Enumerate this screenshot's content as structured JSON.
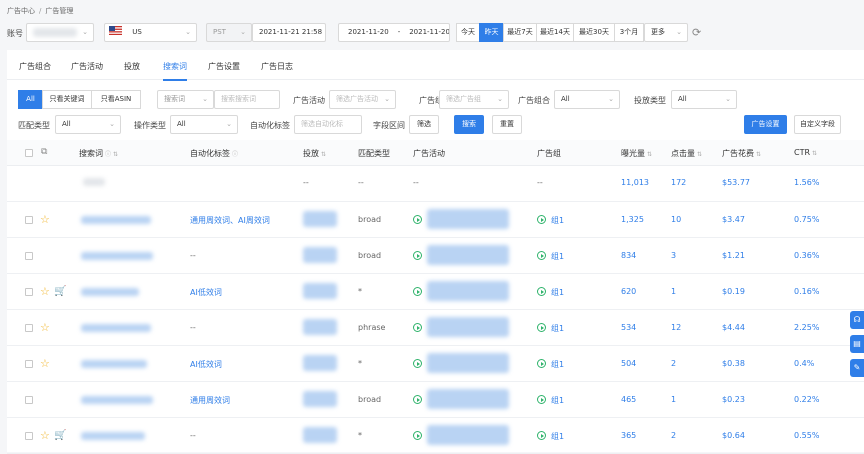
{
  "breadcrumb": {
    "root": "广告中心",
    "sep": "/",
    "current": "广告管理"
  },
  "topbar": {
    "account_label": "账号",
    "market": "US",
    "timezone": "PST",
    "datetime": "2021-11-21 21:58",
    "range_start": "2021-11-20",
    "range_sep": "-",
    "range_end": "2021-11-20",
    "quick_ranges": [
      "今天",
      "昨天",
      "最近7天",
      "最近14天",
      "最近30天",
      "3个月"
    ],
    "active_range": "昨天",
    "more": "更多",
    "refresh_icon": "refresh-icon"
  },
  "tabs": [
    "广告组合",
    "广告活动",
    "投放",
    "搜索词",
    "广告设置",
    "广告日志"
  ],
  "active_tab": "搜索词",
  "filters": {
    "seg_all": "All",
    "seg_keyword": "只看关键词",
    "seg_asin": "只看ASIN",
    "search_type": "搜索词",
    "search_placeholder": "搜索搜索词",
    "campaign_label": "广告活动",
    "campaign_placeholder": "筛选广告活动",
    "group_label": "广告组",
    "group_placeholder": "筛选广告组",
    "portfolio_label": "广告组合",
    "portfolio_value": "All",
    "target_type_label": "投放类型",
    "target_type_value": "All",
    "match_label": "匹配类型",
    "match_value": "All",
    "op_label": "操作类型",
    "op_value": "All",
    "auto_label": "自动化标签",
    "auto_placeholder": "筛选自动化标",
    "field_label": "字段区间",
    "filter_btn": "筛选",
    "search_btn": "搜索",
    "reset_btn": "重置",
    "ad_settings_btn": "广告设置",
    "custom_fields_btn": "自定义字段"
  },
  "columns": [
    "搜索词",
    "自动化标签",
    "投放",
    "匹配类型",
    "广告活动",
    "广告组",
    "曝光量",
    "点击量",
    "广告花费",
    "CTR"
  ],
  "summary": {
    "match": "--",
    "campaign": "--",
    "group": "--",
    "impressions": "11,013",
    "clicks": "172",
    "spend": "$53.77",
    "ctr": "1.56%"
  },
  "rows": [
    {
      "tag": "通用周效词、AI周效词",
      "match": "broad",
      "group": "组1",
      "impressions": "1,325",
      "clicks": "10",
      "spend": "$3.47",
      "ctr": "0.75%",
      "star": true,
      "cart": false
    },
    {
      "tag": "--",
      "match": "broad",
      "group": "组1",
      "impressions": "834",
      "clicks": "3",
      "spend": "$1.21",
      "ctr": "0.36%",
      "star": false,
      "cart": false
    },
    {
      "tag": "AI低效词",
      "match": "*",
      "group": "组1",
      "impressions": "620",
      "clicks": "1",
      "spend": "$0.19",
      "ctr": "0.16%",
      "star": true,
      "cart": true
    },
    {
      "tag": "--",
      "match": "phrase",
      "group": "组1",
      "impressions": "534",
      "clicks": "12",
      "spend": "$4.44",
      "ctr": "2.25%",
      "star": true,
      "cart": false
    },
    {
      "tag": "AI低效词",
      "match": "*",
      "group": "组1",
      "impressions": "504",
      "clicks": "2",
      "spend": "$0.38",
      "ctr": "0.4%",
      "star": true,
      "cart": false
    },
    {
      "tag": "通用周效词",
      "match": "broad",
      "group": "组1",
      "impressions": "465",
      "clicks": "1",
      "spend": "$0.23",
      "ctr": "0.22%",
      "star": false,
      "cart": false
    },
    {
      "tag": "--",
      "match": "*",
      "group": "组1",
      "impressions": "365",
      "clicks": "2",
      "spend": "$0.64",
      "ctr": "0.55%",
      "star": true,
      "cart": true
    }
  ],
  "colors": {
    "accent": "#2f7ee8",
    "status_green": "#2fb36b",
    "star": "#f0b429"
  }
}
